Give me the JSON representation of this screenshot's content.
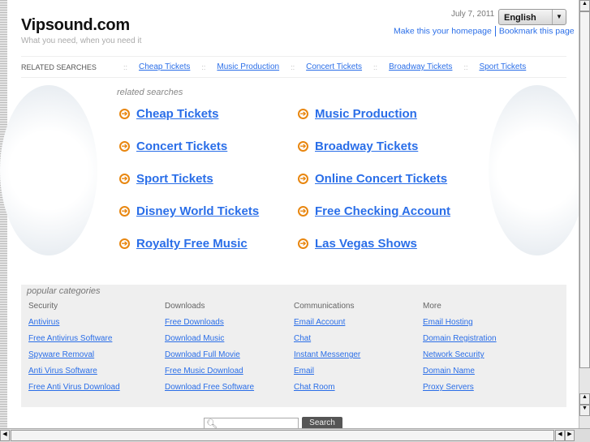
{
  "header": {
    "title": "Vipsound.com",
    "tagline": "What you need, when you need it",
    "date": "July 7, 2011",
    "language": "English",
    "make_homepage": "Make this your homepage",
    "bookmark": "Bookmark this page"
  },
  "related_bar": {
    "label": "RELATED SEARCHES",
    "links": [
      "Cheap Tickets",
      "Music Production",
      "Concert Tickets",
      "Broadway Tickets",
      "Sport Tickets"
    ]
  },
  "related": {
    "heading": "related searches",
    "links": [
      "Cheap Tickets",
      "Music Production",
      "Concert Tickets",
      "Broadway Tickets",
      "Sport Tickets",
      "Online Concert Tickets",
      "Disney World Tickets",
      "Free Checking Account",
      "Royalty Free Music",
      "Las Vegas Shows"
    ]
  },
  "popular": {
    "heading": "popular categories",
    "columns": [
      {
        "title": "Security",
        "links": [
          "Antivirus",
          "Free Antivirus Software",
          "Spyware Removal",
          "Anti Virus Software",
          "Free Anti Virus Download"
        ]
      },
      {
        "title": "Downloads",
        "links": [
          "Free Downloads",
          "Download Music",
          "Download Full Movie",
          "Free Music Download",
          "Download Free Software"
        ]
      },
      {
        "title": "Communications",
        "links": [
          "Email Account",
          "Chat",
          "Instant Messenger",
          "Email",
          "Chat Room"
        ]
      },
      {
        "title": "More",
        "links": [
          "Email Hosting",
          "Domain Registration",
          "Network Security",
          "Domain Name",
          "Proxy Servers"
        ]
      }
    ]
  },
  "search": {
    "button": "Search",
    "value": ""
  }
}
